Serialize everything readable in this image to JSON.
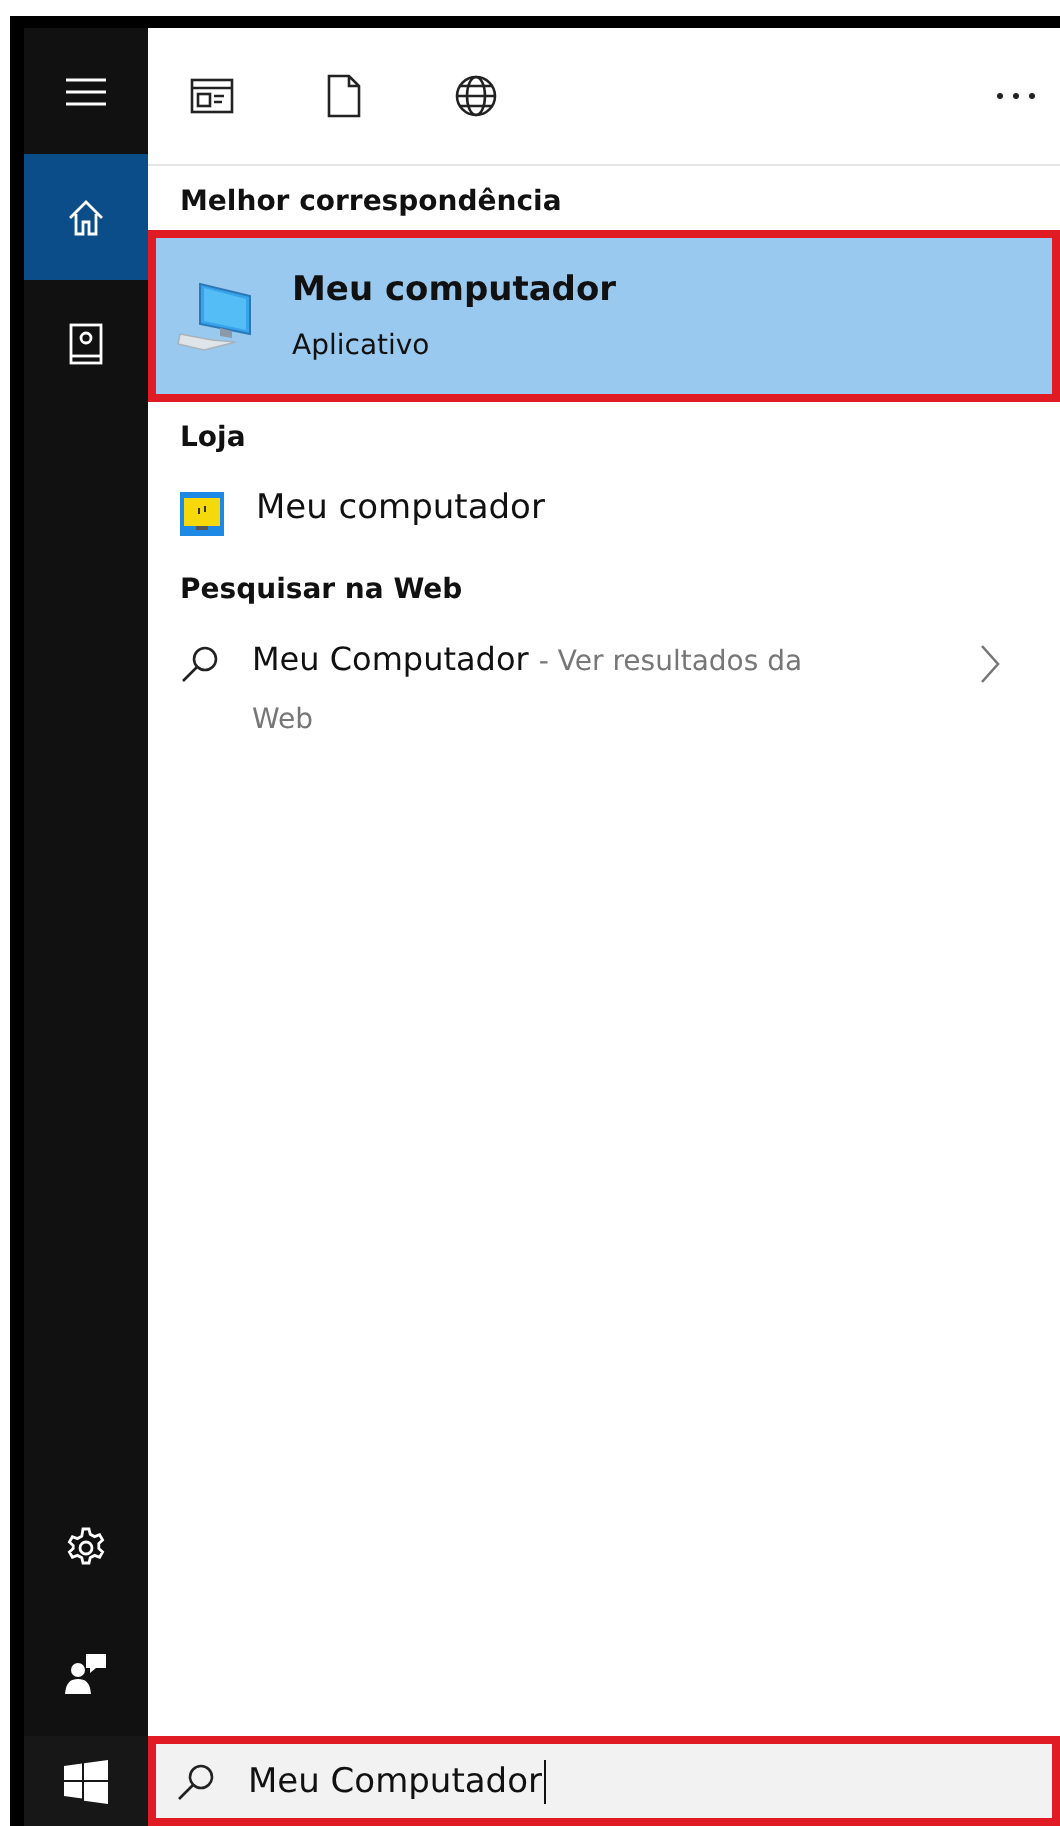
{
  "sidebar": {
    "top_items": [
      {
        "kind": "menu",
        "selected": false
      },
      {
        "kind": "home",
        "selected": true
      },
      {
        "kind": "notebook",
        "selected": false
      }
    ],
    "bottom_items": [
      {
        "kind": "settings",
        "selected": false
      },
      {
        "kind": "feedback",
        "selected": false
      }
    ]
  },
  "toolbar": [
    {
      "kind": "apps"
    },
    {
      "kind": "documents"
    },
    {
      "kind": "web"
    },
    {
      "kind": "more"
    }
  ],
  "sections": [
    {
      "heading": "Melhor correspondência",
      "results": [
        {
          "kind": "app",
          "title": "Meu computador",
          "subtitle": "Aplicativo",
          "selected": true,
          "outlined": true
        }
      ]
    },
    {
      "heading": "Loja",
      "results": [
        {
          "kind": "store",
          "title": "Meu computador",
          "selected": false,
          "outlined": false
        }
      ]
    },
    {
      "heading": "Pesquisar na Web",
      "results": [
        {
          "kind": "web",
          "title": "Meu Computador",
          "suffix": "- Ver resultados da Web",
          "selected": false,
          "outlined": false
        }
      ]
    }
  ],
  "search": {
    "value": "Meu Computador",
    "outlined": true
  }
}
